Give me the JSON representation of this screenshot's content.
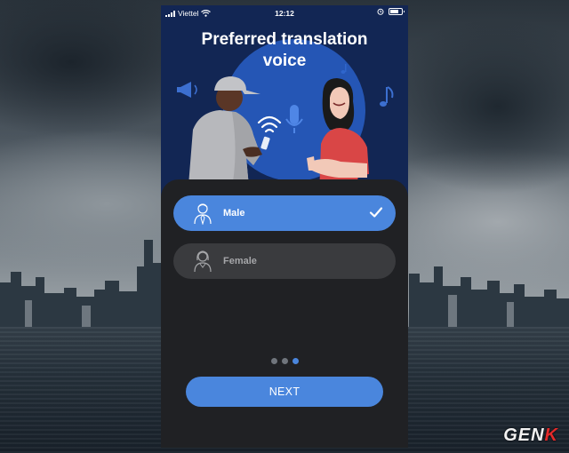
{
  "status_bar": {
    "carrier": "Viettel",
    "time": "12:12"
  },
  "hero": {
    "title": "Preferred translation\nvoice"
  },
  "options": [
    {
      "label": "Male",
      "selected": true,
      "icon": "male-avatar-icon"
    },
    {
      "label": "Female",
      "selected": false,
      "icon": "female-avatar-icon"
    }
  ],
  "pagination": {
    "total": 3,
    "current": 3
  },
  "next_button": {
    "label": "NEXT"
  },
  "watermark": {
    "text_main": "GEN",
    "text_accent": "K"
  },
  "colors": {
    "hero_bg": "#122654",
    "accent": "#4a86dd",
    "sheet_bg": "#202124",
    "option_inactive": "#3a3b3e"
  }
}
